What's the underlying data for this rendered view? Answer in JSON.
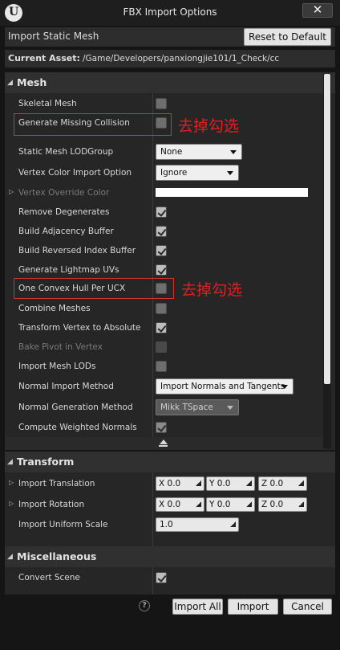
{
  "window": {
    "title": "FBX Import Options",
    "close_label": "✕"
  },
  "import_type": {
    "label": "Import Static Mesh",
    "reset_label": "Reset to Default"
  },
  "current_asset": {
    "label": "Current Asset:",
    "path": "/Game/Developers/panxiongjie101/1_Check/cc"
  },
  "mesh_section": {
    "title": "Mesh",
    "skeletal_mesh": {
      "label": "Skeletal Mesh",
      "checked": false
    },
    "generate_missing_collision": {
      "label": "Generate Missing Collision",
      "checked": false
    },
    "static_mesh_lod_group": {
      "label": "Static Mesh LODGroup",
      "value": "None"
    },
    "vertex_color_import_option": {
      "label": "Vertex Color Import Option",
      "value": "Ignore"
    },
    "vertex_override_color": {
      "label": "Vertex Override Color",
      "color": "#ffffff"
    },
    "remove_degenerates": {
      "label": "Remove Degenerates",
      "checked": true
    },
    "build_adjacency_buffer": {
      "label": "Build Adjacency Buffer",
      "checked": true
    },
    "build_reversed_index_buffer": {
      "label": "Build Reversed Index Buffer",
      "checked": true
    },
    "generate_lightmap_uvs": {
      "label": "Generate Lightmap UVs",
      "checked": true
    },
    "one_convex_hull_per_ucx": {
      "label": "One Convex Hull Per UCX",
      "checked": false
    },
    "combine_meshes": {
      "label": "Combine Meshes",
      "checked": false
    },
    "transform_vertex_to_absolute": {
      "label": "Transform Vertex to Absolute",
      "checked": true
    },
    "bake_pivot_in_vertex": {
      "label": "Bake Pivot in Vertex",
      "checked": false
    },
    "import_mesh_lods": {
      "label": "Import Mesh LODs",
      "checked": false
    },
    "normal_import_method": {
      "label": "Normal Import Method",
      "value": "Import Normals and Tangents"
    },
    "normal_generation_method": {
      "label": "Normal Generation Method",
      "value": "Mikk TSpace"
    },
    "compute_weighted_normals": {
      "label": "Compute Weighted Normals",
      "checked": true
    }
  },
  "annotations": {
    "note1": "去掉勾选",
    "note2": "去掉勾选",
    "color": "#e02020"
  },
  "transform_section": {
    "title": "Transform",
    "import_translation": {
      "label": "Import Translation",
      "x": "X  0.0",
      "y": "Y  0.0",
      "z": "Z  0.0"
    },
    "import_rotation": {
      "label": "Import Rotation",
      "x": "X  0.0",
      "y": "Y  0.0",
      "z": "Z  0.0"
    },
    "import_uniform_scale": {
      "label": "Import Uniform Scale",
      "value": "1.0"
    }
  },
  "misc_section": {
    "title": "Miscellaneous",
    "convert_scene": {
      "label": "Convert Scene",
      "checked": true
    }
  },
  "footer": {
    "help": "?",
    "import_all": "Import All",
    "import": "Import",
    "cancel": "Cancel"
  }
}
